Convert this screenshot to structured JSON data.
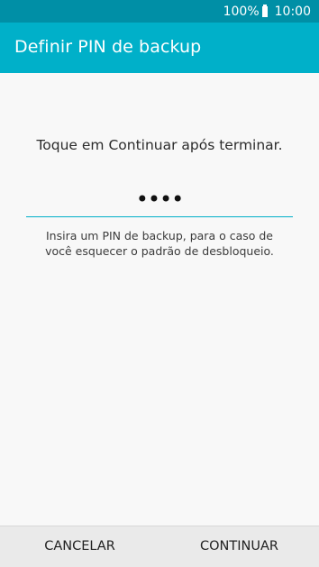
{
  "status_bar": {
    "battery_percent": "100%",
    "battery_icon": "battery-full-icon",
    "time": "10:00"
  },
  "app_bar": {
    "title": "Definir PIN de backup"
  },
  "main": {
    "instruction": "Toque em Continuar após terminar.",
    "pin_value": "••••",
    "hint_line1": "Insira um PIN de backup, para o caso de",
    "hint_line2": "você esquecer o padrão de desbloqueio."
  },
  "bottom_bar": {
    "cancel_label": "CANCELAR",
    "continue_label": "CONTINUAR"
  },
  "colors": {
    "status_bar": "#008fa6",
    "app_bar": "#00b0c9",
    "accent_underline": "#00b0c9",
    "background": "#f8f8f8",
    "bottom_bar": "#eaeaea"
  }
}
